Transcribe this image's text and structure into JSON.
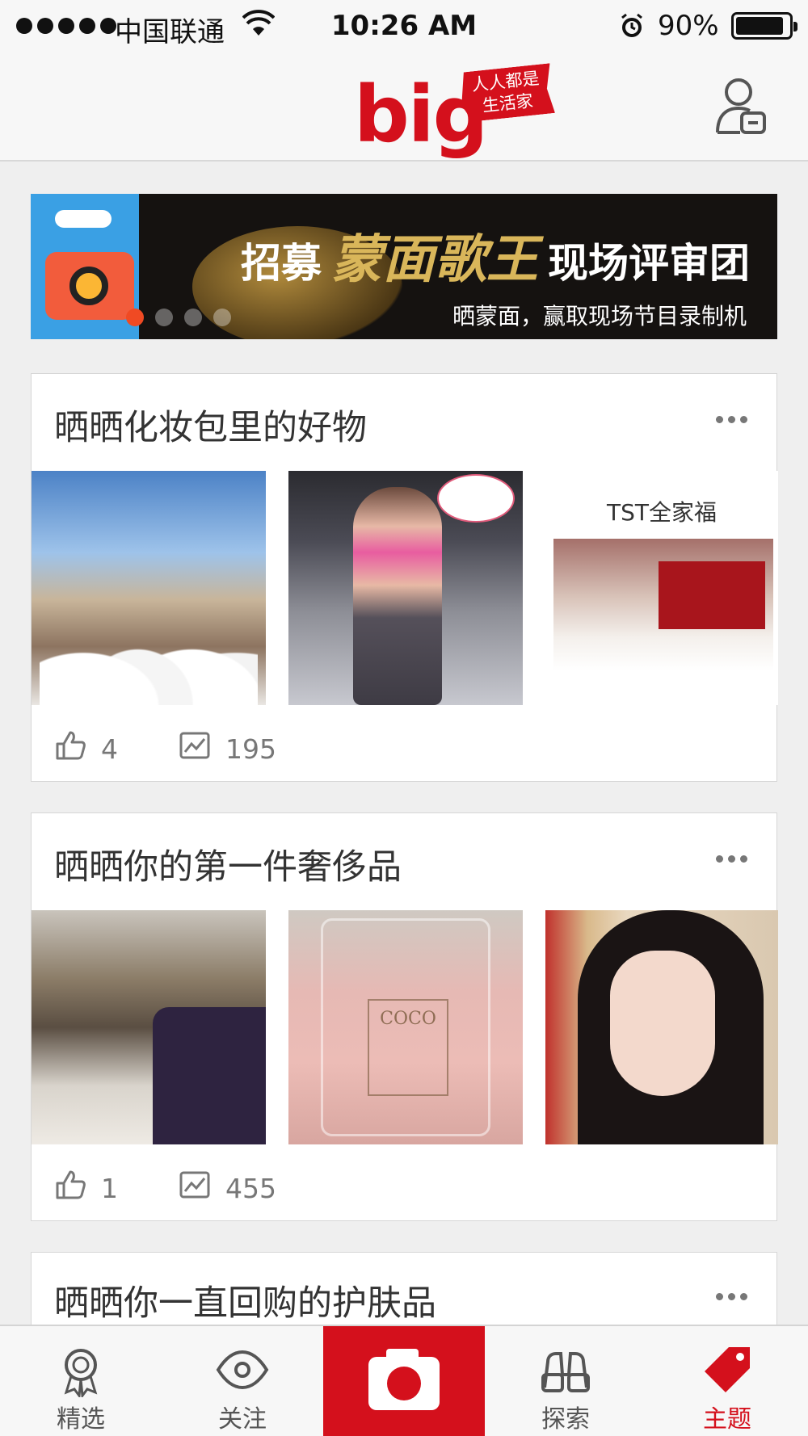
{
  "status_bar": {
    "carrier": "中国联通",
    "time": "10:26 AM",
    "battery": "90%",
    "icons": [
      "signal-dots",
      "wifi-icon",
      "alarm-icon",
      "battery-icon"
    ]
  },
  "header": {
    "logo_word": "big",
    "logo_tag_line1": "人人都是",
    "logo_tag_line2": "生活家",
    "brand_color": "#d4101c",
    "right_icon": "profile-card-icon"
  },
  "banner": {
    "headline_left": "招募",
    "headline_gold": "蒙面歌王",
    "headline_right": "现场评审团",
    "subtitle": "晒蒙面，赢取现场节目录制机",
    "dots": 4,
    "active_dot": 0
  },
  "topics": [
    {
      "title": "晒晒化妆包里的好物",
      "likes": "4",
      "photos_count": "195",
      "thumbs": [
        "wedding-dress-group-photo",
        "gym-selfie-photo",
        "tst-products-photo"
      ],
      "tst_label": "TST全家福"
    },
    {
      "title": "晒晒你的第一件奢侈品",
      "likes": "1",
      "photos_count": "455",
      "thumbs": [
        "living-room-sofa-photo",
        "coco-perfume-photo",
        "girl-selfie-photo"
      ],
      "perfume_label": "COCO"
    },
    {
      "title": "晒晒你一直回购的护肤品"
    }
  ],
  "tab_bar": {
    "tabs": [
      {
        "label": "精选",
        "icon": "badge-icon",
        "active": false
      },
      {
        "label": "关注",
        "icon": "eye-icon",
        "active": false
      },
      {
        "label": "",
        "icon": "camera-icon",
        "active": false
      },
      {
        "label": "探索",
        "icon": "binoculars-icon",
        "active": false
      },
      {
        "label": "主题",
        "icon": "tag-icon",
        "active": true
      }
    ]
  }
}
